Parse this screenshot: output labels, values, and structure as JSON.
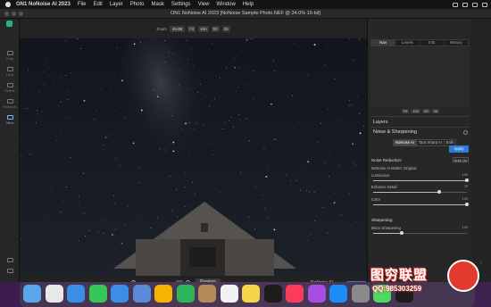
{
  "menubar": {
    "items": [
      "ON1 NoNoise AI 2023",
      "File",
      "Edit",
      "Layer",
      "Photo",
      "Mask",
      "Settings",
      "View",
      "Window",
      "Help"
    ]
  },
  "window": {
    "title": "ON1 NoNoise AI 2023 [NoNoise Sample Photo.NEF @ 34.0% 16-bit]"
  },
  "left_tools": [
    "Crop",
    "Heal",
    "Refine",
    "Retouch",
    "View"
  ],
  "zoombar": {
    "zoom_label": "Zoom",
    "zoom_value": "33.96",
    "buttons": [
      "Fit",
      "100",
      "50",
      "25"
    ]
  },
  "bottombar": {
    "preview_label": "Preview",
    "nonoise_label": "NoNoise AI"
  },
  "navigator": {
    "tabs": [
      "Nav",
      "Levels",
      "Info",
      "History"
    ],
    "active_tab": "Nav",
    "zoom_buttons": [
      "Fit",
      "100",
      "50",
      "25"
    ]
  },
  "panel": {
    "layers_heading": "Layers",
    "section_title": "Noise & Sharpening",
    "modes": [
      "NoNoise AI",
      "Tack Sharp AI",
      "Both"
    ],
    "active_mode": "NoNoise AI",
    "apply_label": "Apply",
    "noise_reduction_heading": "Noise Reduction:",
    "auto_label": "Auto On",
    "model_label": "NoNoise AI Model:",
    "model_value": "Original",
    "sliders": [
      {
        "label": "Luminance",
        "value": "100",
        "fraction": 1.0
      },
      {
        "label": "Enhance Detail",
        "value": "70",
        "fraction": 0.7
      },
      {
        "label": "Color",
        "value": "100",
        "fraction": 1.0
      }
    ],
    "sharpening_heading": "Sharpening:",
    "sharpening_slider": {
      "label": "Micro Sharpening",
      "value": "100",
      "fraction": 0.3
    }
  },
  "dock_colors": [
    "#5aa6e8",
    "#e8e8e8",
    "#3a8ee6",
    "#35c759",
    "#3a8ee6",
    "#5b8ad9",
    "#f4b400",
    "#2fb55a",
    "#b48a56",
    "#f2f2f2",
    "#f7d54a",
    "#1c1c1c",
    "#fa3c5a",
    "#a84ce6",
    "#1b8ef5",
    "#8a8a8a",
    "#4cd964",
    "#1c1c1c"
  ],
  "watermark": {
    "line1": "图穷联盟",
    "line2": "QQ:985303259"
  }
}
